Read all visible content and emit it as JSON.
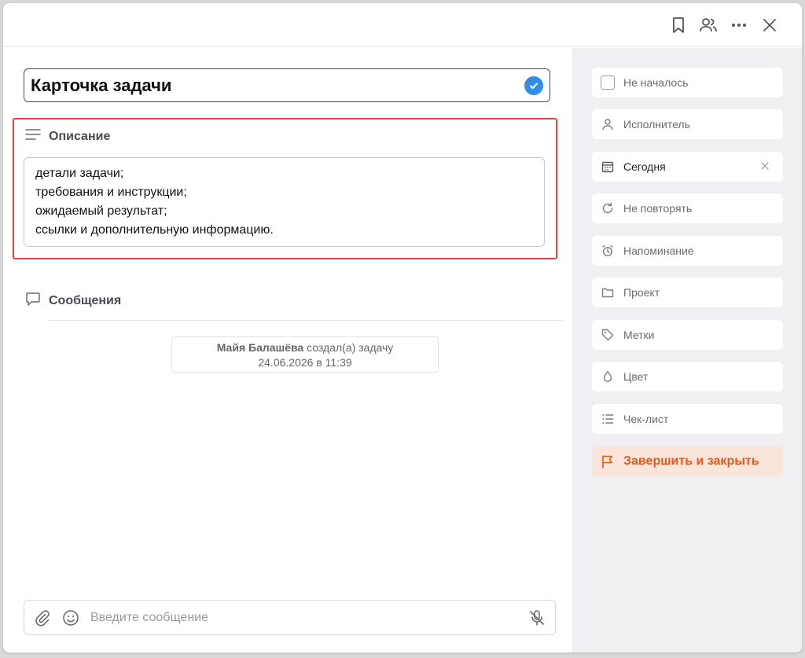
{
  "task": {
    "title": "Карточка задачи"
  },
  "description": {
    "heading": "Описание",
    "lines": [
      "детали задачи;",
      "требования и инструкции;",
      "ожидаемый результат;",
      "ссылки и дополнительную информацию."
    ]
  },
  "messages": {
    "heading": "Сообщения",
    "system_message": {
      "author": "Майя Балашёва",
      "action": "создал(а) задачу",
      "timestamp": "24.06.2026 в 11:39"
    }
  },
  "composer": {
    "placeholder": "Введите сообщение"
  },
  "sidebar": {
    "status": "Не началось",
    "assignee": "Исполнитель",
    "date": "Сегодня",
    "repeat": "Не повторять",
    "reminder": "Напоминание",
    "project": "Проект",
    "tags": "Метки",
    "color": "Цвет",
    "checklist": "Чек-лист",
    "finish": "Завершить и закрыть"
  },
  "colors": {
    "accent_blue": "#2f8fe6",
    "highlight_red": "#ee3d3d",
    "finish_orange": "#e35a1b",
    "finish_bg": "#fbe4da",
    "sidebar_bg": "#f0f0f2"
  }
}
